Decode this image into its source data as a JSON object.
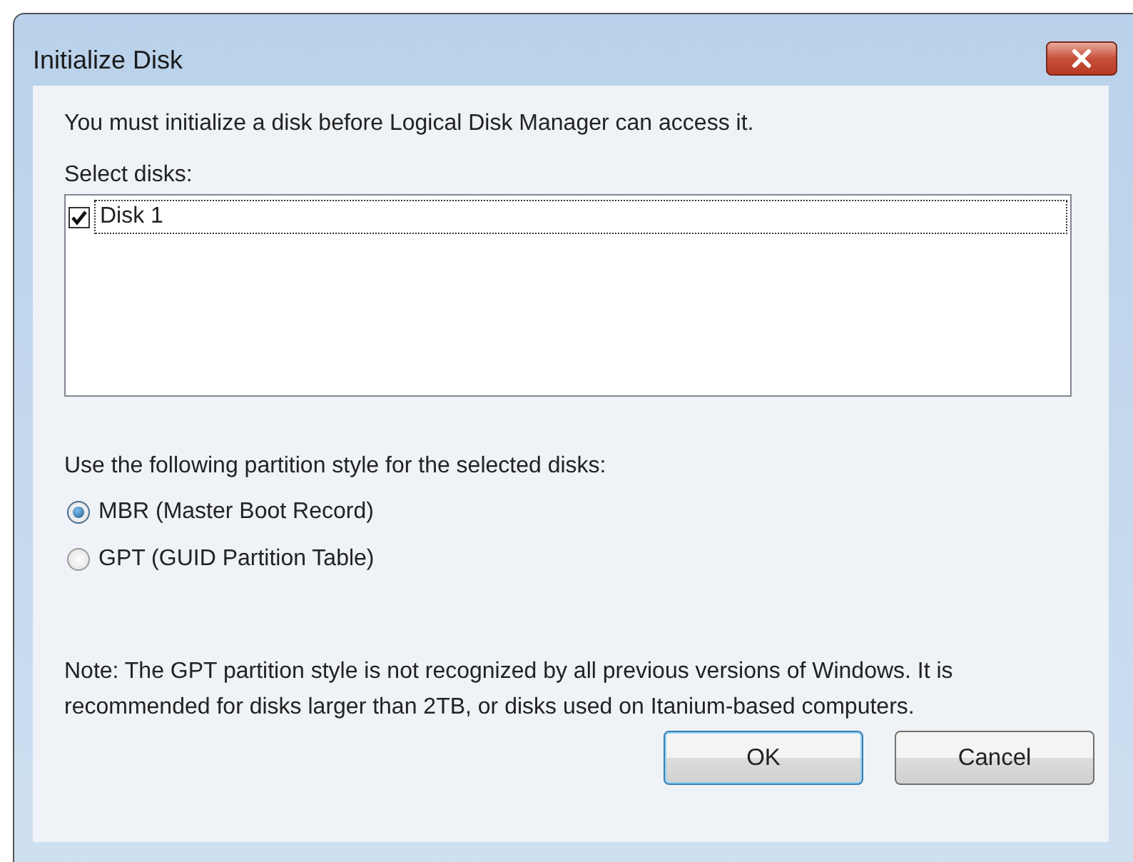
{
  "window": {
    "title": "Initialize Disk"
  },
  "intro": "You must initialize a disk before Logical Disk Manager can access it.",
  "disks_label": "Select disks:",
  "disks": [
    {
      "label": "Disk 1",
      "checked": true,
      "selected": true
    }
  ],
  "style_label": "Use the following partition style for the selected disks:",
  "styles": [
    {
      "label": "MBR (Master Boot Record)",
      "selected": true
    },
    {
      "label": "GPT (GUID Partition Table)",
      "selected": false
    }
  ],
  "note": "Note: The GPT partition style is not recognized by all previous versions of Windows. It is recommended for disks larger than 2TB, or disks used on Itanium-based computers.",
  "buttons": [
    {
      "label": "OK",
      "default": true
    },
    {
      "label": "Cancel",
      "default": false
    }
  ]
}
